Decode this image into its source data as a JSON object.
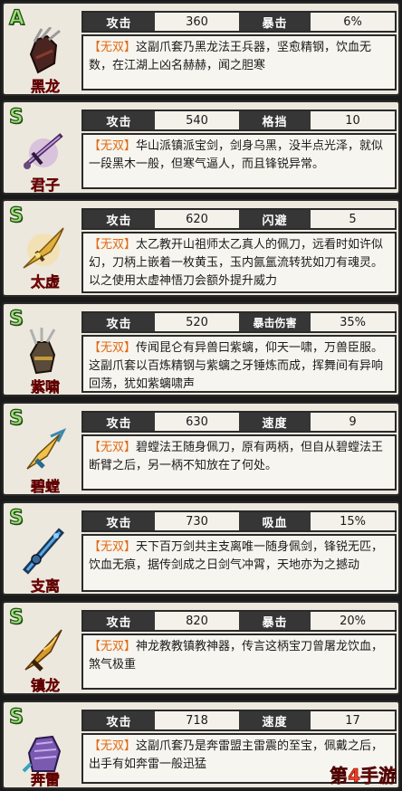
{
  "weapons": [
    {
      "grade": "A",
      "name": "黑龙",
      "stat1_label": "攻击",
      "stat1_value": "360",
      "stat2_label": "暴击",
      "stat2_value": "6%",
      "tag": "【无双】",
      "description": "这副爪套乃黑龙法王兵器，坚愈精钢，饮血无数，在江湖上凶名赫赫，闻之胆寒",
      "icon": "claw-gauntlet-icon"
    },
    {
      "grade": "S",
      "name": "君子",
      "stat1_label": "攻击",
      "stat1_value": "540",
      "stat2_label": "格挡",
      "stat2_value": "10",
      "tag": "【无双】",
      "description": "华山派镇派宝剑，剑身乌黑，没半点光泽，就似一段黑木一般，但寒气逼人，而且锋锐异常。",
      "icon": "purple-sword-icon"
    },
    {
      "grade": "S",
      "name": "太虚",
      "stat1_label": "攻击",
      "stat1_value": "620",
      "stat2_label": "闪避",
      "stat2_value": "5",
      "tag": "【无双】",
      "description": "太乙教开山祖师太乙真人的佩刀，远看时如许似幻，刀柄上嵌着一枚黄玉，玉内氤氲流转犹如刀有魂灵。以之使用太虚神悟刀会额外提升威力",
      "icon": "golden-blade-icon"
    },
    {
      "grade": "S",
      "name": "紫啸",
      "stat1_label": "攻击",
      "stat1_value": "520",
      "stat2_label": "暴击伤害",
      "stat2_value": "35%",
      "tag": "【无双】",
      "description": "传闻昆仑有异兽曰紫螭，仰天一啸，万兽臣服。这副爪套以百炼精钢与紫螭之牙锤炼而成，挥舞间有异响回荡，犹如紫螭啸声",
      "icon": "purple-claw-icon"
    },
    {
      "grade": "S",
      "name": "碧螳",
      "stat1_label": "攻击",
      "stat1_value": "630",
      "stat2_label": "速度",
      "stat2_value": "9",
      "tag": "【无双】",
      "description": "碧螳法王随身佩刀，原有两柄，但自从碧螳法王断臂之后，另一柄不知放在了何处。",
      "icon": "mantis-dagger-icon"
    },
    {
      "grade": "S",
      "name": "支离",
      "stat1_label": "攻击",
      "stat1_value": "730",
      "stat2_label": "吸血",
      "stat2_value": "15%",
      "tag": "【无双】",
      "description": "天下百万剑共主支离唯一随身佩剑，锋锐无匹，饮血无痕，据传剑成之日剑气冲霄，天地亦为之撼动",
      "icon": "blue-sword-icon"
    },
    {
      "grade": "S",
      "name": "镇龙",
      "stat1_label": "攻击",
      "stat1_value": "820",
      "stat2_label": "暴击",
      "stat2_value": "20%",
      "tag": "【无双】",
      "description": "神龙教教镇教神器，传言这柄宝刀曾屠龙饮血，煞气极重",
      "icon": "dragon-blade-icon"
    },
    {
      "grade": "S",
      "name": "奔雷",
      "stat1_label": "攻击",
      "stat1_value": "718",
      "stat2_label": "速度",
      "stat2_value": "17",
      "tag": "【无双】",
      "description": "这副爪套乃是奔雷盟主雷震的至宝，佩戴之后，出手有如奔雷一般迅猛",
      "icon": "thunder-gauntlet-icon"
    }
  ],
  "watermark": "第4手游",
  "colors": {
    "grade": "#9fe07a",
    "name": "#c0161b",
    "tag": "#e06a15",
    "label_bg": "#363636"
  }
}
